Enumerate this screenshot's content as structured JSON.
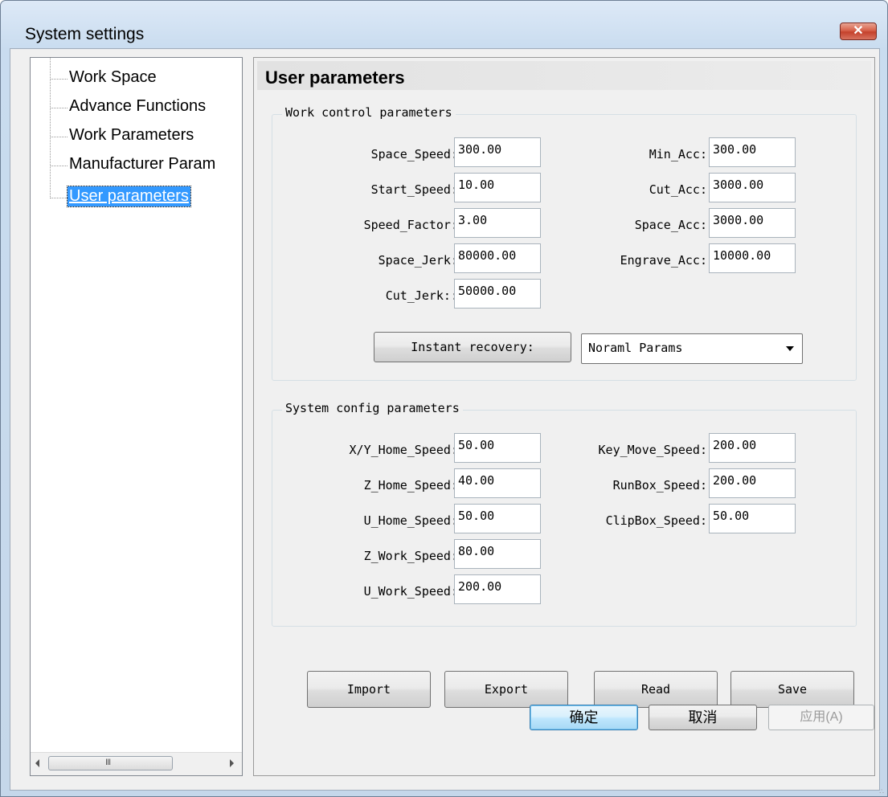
{
  "window": {
    "title": "System settings"
  },
  "tree": {
    "items": [
      {
        "label": "Work Space"
      },
      {
        "label": "Advance Functions"
      },
      {
        "label": "Work Parameters"
      },
      {
        "label": "Manufacturer Param"
      },
      {
        "label": "User parameters",
        "selected": true
      }
    ],
    "scroll_grip": "III"
  },
  "panel": {
    "title": "User parameters",
    "work_control": {
      "title": "Work control parameters",
      "left": [
        {
          "label": "Space_Speed:",
          "value": "300.00"
        },
        {
          "label": "Start_Speed:",
          "value": "10.00"
        },
        {
          "label": "Speed_Factor:",
          "value": "3.00"
        },
        {
          "label": "Space_Jerk:",
          "value": "80000.00"
        },
        {
          "label": "Cut_Jerk::",
          "value": "50000.00"
        }
      ],
      "right": [
        {
          "label": "Min_Acc:",
          "value": "300.00"
        },
        {
          "label": "Cut_Acc:",
          "value": "3000.00"
        },
        {
          "label": "Space_Acc:",
          "value": "3000.00"
        },
        {
          "label": "Engrave_Acc:",
          "value": "10000.00"
        }
      ],
      "recovery_button": "Instant recovery:",
      "params_select": "Noraml Params"
    },
    "system_config": {
      "title": "System config parameters",
      "left": [
        {
          "label": "X/Y_Home_Speed:",
          "value": "50.00"
        },
        {
          "label": "Z_Home_Speed:",
          "value": "40.00"
        },
        {
          "label": "U_Home_Speed:",
          "value": "50.00"
        },
        {
          "label": "Z_Work_Speed:",
          "value": "80.00"
        },
        {
          "label": "U_Work_Speed:",
          "value": "200.00"
        }
      ],
      "right": [
        {
          "label": "Key_Move_Speed:",
          "value": "200.00"
        },
        {
          "label": "RunBox_Speed:",
          "value": "200.00"
        },
        {
          "label": "ClipBox_Speed:",
          "value": "50.00"
        }
      ]
    },
    "actions": {
      "import": "Import",
      "export": "Export",
      "read": "Read",
      "save": "Save"
    }
  },
  "dialog": {
    "ok": "确定",
    "cancel": "取消",
    "apply": "应用(A)"
  },
  "colors": {
    "selection": "#3399ff",
    "close_button": "#c4412c",
    "title_bar": "#c9dcef"
  },
  "icons": [
    "close-icon",
    "scroll-left-icon",
    "scroll-right-icon",
    "dropdown-caret-icon",
    "resize-grip-icon"
  ]
}
